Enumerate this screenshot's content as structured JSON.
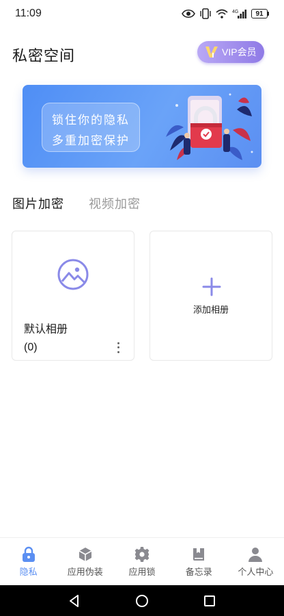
{
  "status_bar": {
    "time": "11:09",
    "network": "4G",
    "battery": "91"
  },
  "header": {
    "title": "私密空间",
    "vip_label": "VIP会员"
  },
  "banner": {
    "line1": "锁住你的隐私",
    "line2": "多重加密保护"
  },
  "tabs": [
    {
      "label": "图片加密",
      "active": true
    },
    {
      "label": "视频加密",
      "active": false
    }
  ],
  "albums": [
    {
      "name": "默认相册",
      "count": "(0)"
    }
  ],
  "add_album": {
    "label": "添加相册"
  },
  "bottom_nav": [
    {
      "label": "隐私",
      "icon": "lock-icon",
      "active": true
    },
    {
      "label": "应用伪装",
      "icon": "cube-icon",
      "active": false
    },
    {
      "label": "应用锁",
      "icon": "gear-icon",
      "active": false
    },
    {
      "label": "备忘录",
      "icon": "notebook-icon",
      "active": false
    },
    {
      "label": "个人中心",
      "icon": "person-icon",
      "active": false
    }
  ],
  "colors": {
    "accent": "#5b8ff2",
    "icon_purple": "#8a8ae8",
    "nav_icon_gray": "#8a8a90",
    "vip_gradient_start": "#b9a8f5",
    "vip_gradient_end": "#8f7ae6"
  }
}
